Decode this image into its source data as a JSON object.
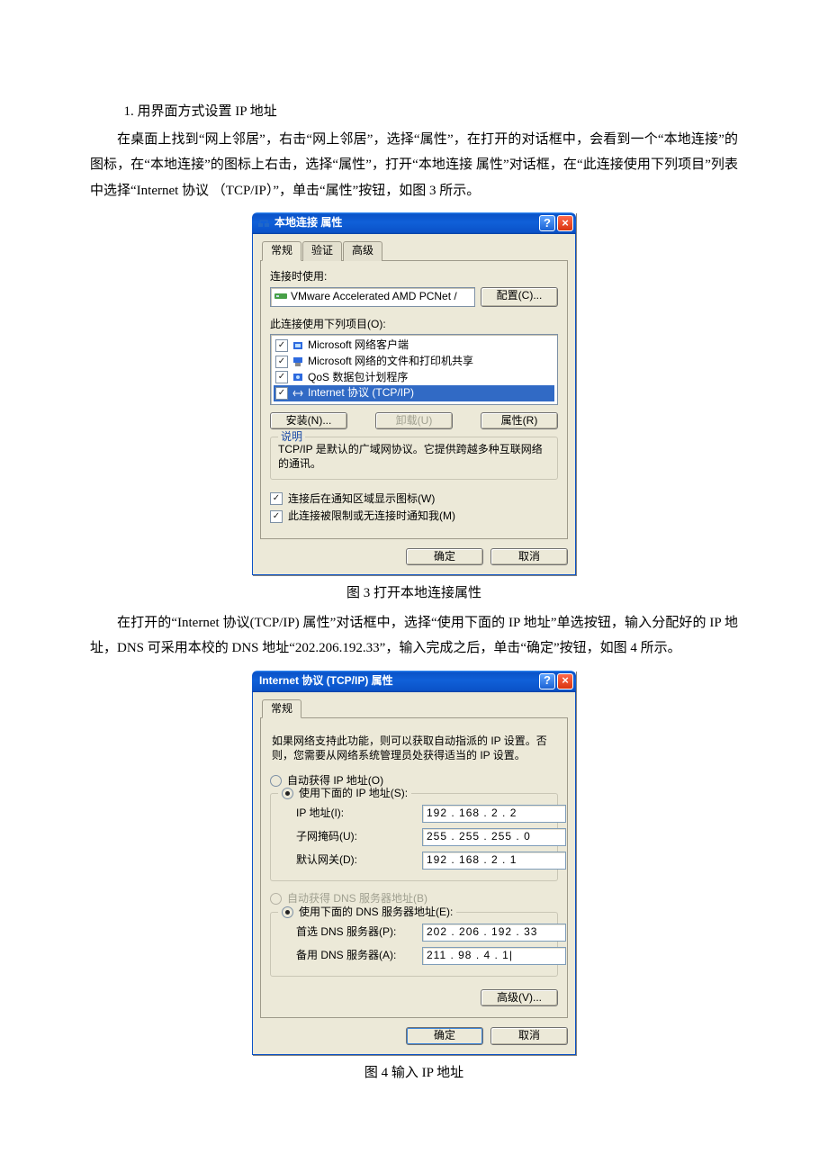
{
  "doc": {
    "h1": "1. 用界面方式设置 IP 地址",
    "para1": "在桌面上找到“网上邻居”，右击“网上邻居”，选择“属性”，在打开的对话框中，会看到一个“本地连接”的图标，在“本地连接”的图标上右击，选择“属性”，打开“本地连接 属性”对话框，在“此连接使用下列项目”列表中选择“Internet 协议 （TCP/IP）”，单击“属性”按钮，如图 3 所示。",
    "caption3": "图 3 打开本地连接属性",
    "para2": "在打开的“Internet 协议(TCP/IP) 属性”对话框中，选择“使用下面的 IP 地址”单选按钮，输入分配好的 IP 地址，DNS 可采用本校的 DNS 地址“202.206.192.33”，输入完成之后，单击“确定”按钮，如图 4 所示。",
    "caption4": "图 4 输入 IP 地址"
  },
  "dlg1": {
    "title": "本地连接 属性",
    "tabs": [
      "常规",
      "验证",
      "高级"
    ],
    "connect_using_label": "连接时使用:",
    "adapter": "VMware Accelerated AMD PCNet /",
    "btn_config": "配置(C)...",
    "items_label": "此连接使用下列项目(O):",
    "items": [
      {
        "label": "Microsoft 网络客户端"
      },
      {
        "label": "Microsoft 网络的文件和打印机共享"
      },
      {
        "label": "QoS 数据包计划程序"
      },
      {
        "label": "Internet 协议 (TCP/IP)"
      }
    ],
    "btn_install": "安装(N)...",
    "btn_uninstall": "卸载(U)",
    "btn_props": "属性(R)",
    "desc_legend": "说明",
    "desc_text": "TCP/IP 是默认的广域网协议。它提供跨越多种互联网络的通讯。",
    "chk_tray": "连接后在通知区域显示图标(W)",
    "chk_notify": "此连接被限制或无连接时通知我(M)",
    "btn_ok": "确定",
    "btn_cancel": "取消"
  },
  "dlg2": {
    "title": "Internet 协议 (TCP/IP) 属性",
    "tab": "常规",
    "hint": "如果网络支持此功能，则可以获取自动指派的 IP 设置。否则，您需要从网络系统管理员处获得适当的 IP 设置。",
    "r_auto_ip": "自动获得 IP 地址(O)",
    "r_manual_ip": "使用下面的 IP 地址(S):",
    "lbl_ip": "IP 地址(I):",
    "lbl_mask": "子网掩码(U):",
    "lbl_gw": "默认网关(D):",
    "val_ip": "192 . 168 .  2  .  2",
    "val_mask": "255 . 255 . 255 .  0",
    "val_gw": "192 . 168 .  2  .  1",
    "r_auto_dns": "自动获得 DNS 服务器地址(B)",
    "r_manual_dns": "使用下面的 DNS 服务器地址(E):",
    "lbl_dns1": "首选 DNS 服务器(P):",
    "lbl_dns2": "备用 DNS 服务器(A):",
    "val_dns1": "202 . 206 . 192 . 33",
    "val_dns2": "211 .  98 .  4  .  1|",
    "btn_adv": "高级(V)...",
    "btn_ok": "确定",
    "btn_cancel": "取消"
  }
}
